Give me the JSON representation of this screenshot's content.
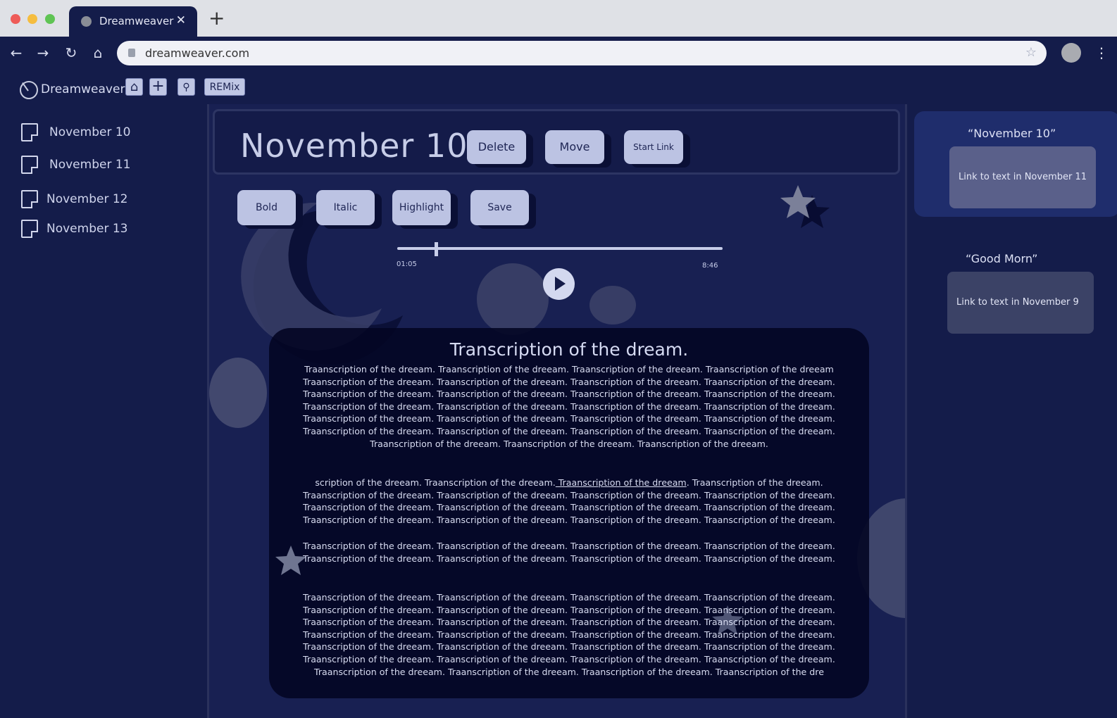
{
  "browser": {
    "tab_title": "Dreamweaver",
    "url": "dreamweaver.com",
    "new_tab": "+"
  },
  "app": {
    "brand": "Dreamweaver",
    "remix_label": "REMix"
  },
  "sidebar": {
    "items": [
      {
        "label": "November 10"
      },
      {
        "label": "November 11"
      },
      {
        "label": "November 12"
      },
      {
        "label": "November 13"
      }
    ]
  },
  "note": {
    "title": "November 10",
    "actions": {
      "delete": "Delete",
      "move": "Move",
      "start_link": "Start Link"
    },
    "format": {
      "bold": "Bold",
      "italic": "Italic",
      "highlight": "Highlight",
      "save": "Save"
    }
  },
  "player": {
    "elapsed": "01:05",
    "duration": "8:46",
    "progress": 0.12
  },
  "transcript": {
    "heading": "Transcription of the dream.",
    "p1": "Traanscription of the dreeam. Traanscription of the dreeam. Traanscription of the dreeam. Traanscription of the dreeam\nTraanscription of the dreeam. Traanscription of the dreeam. Traanscription of the dreeam. Traanscription of the dreeam.\nTraanscription of the dreeam. Traanscription of the dreeam. Traanscription of the dreeam. Traanscription of the dreeam.\nTraanscription of the dreeam. Traanscription of the dreeam. Traanscription of the dreeam. Traanscription of the dreeam.\nTraanscription of the dreeam. Traanscription of the dreeam. Traanscription of the dreeam. Traanscription of the dreeam.\nTraanscription of the dreeam. Traanscription of the dreeam. Traanscription of the dreeam. Traanscription of the dreeam.\nTraanscription of the dreeam. Traanscription of the dreeam. Traanscription of the dreeam.",
    "p2_before": "scription of the dreeam. Traanscription of the dreeam.",
    "p2_link": " Traanscription of the dreeam",
    "p2_after": ". Traanscription of the dreeam.\nTraanscription of the dreeam. Traanscription of the dreeam. Traanscription of the dreeam. Traanscription of the dreeam.\nTraanscription of the dreeam. Traanscription of the dreeam. Traanscription of the dreeam. Traanscription of the dreeam.\nTraanscription of the dreeam. Traanscription of the dreeam. Traanscription of the dreeam. Traanscription of the dreeam.",
    "p3": "Traanscription of the dreeam. Traanscription of the dreeam. Traanscription of the dreeam. Traanscription of the dreeam.\nTraanscription of the dreeam. Traanscription of the dreeam. Traanscription of the dreeam. Traanscription of the dreeam.",
    "p4": "Traanscription of the dreeam. Traanscription of the dreeam. Traanscription of the dreeam. Traanscription of the dreeam.\nTraanscription of the dreeam. Traanscription of the dreeam. Traanscription of the dreeam. Traanscription of the dreeam.\nTraanscription of the dreeam. Traanscription of the dreeam. Traanscription of the dreeam. Traanscription of the dreeam.\nTraanscription of the dreeam. Traanscription of the dreeam. Traanscription of the dreeam. Traanscription of the dreeam.\nTraanscription of the dreeam. Traanscription of the dreeam. Traanscription of the dreeam. Traanscription of the dreeam.\nTraanscription of the dreeam. Traanscription of the dreeam. Traanscription of the dreeam. Traanscription of the dreeam.\nTraanscription of the dreeam. Traanscription of the dreeam. Traanscription of the dreeam. Traanscription of the dre"
  },
  "links": [
    {
      "quote": "“November 10”",
      "text": "Link to text in November 11"
    },
    {
      "quote": "“Good Morn”",
      "text": "Link to text in November 9"
    }
  ],
  "colors": {
    "background": "#141c4a",
    "panel": "#182052",
    "button": "#bcc3e3",
    "active_link_card": "#1f2d6c"
  },
  "icons": [
    "back-icon",
    "forward-icon",
    "reload-icon",
    "home-icon",
    "lock-icon",
    "bookmark-star-icon",
    "profile-icon",
    "more-icon",
    "logo-moon-icon",
    "app-home-icon",
    "add-icon",
    "search-icon",
    "document-icon",
    "play-icon",
    "star-icon",
    "moon-icon"
  ]
}
